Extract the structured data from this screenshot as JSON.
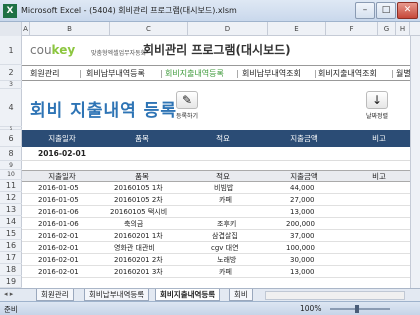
{
  "window": {
    "app_icon": "X",
    "title": "Microsoft Excel - (5404) 회비관리 프로그램(대시보드).xlsm",
    "min_label": "–",
    "max_label": "□",
    "close_label": "✕"
  },
  "columns": [
    "A",
    "B",
    "C",
    "D",
    "E",
    "F",
    "G",
    "H"
  ],
  "rows": [
    "1",
    "2",
    "3",
    "4",
    "5",
    "6",
    "7",
    "8",
    "9",
    "10",
    "11",
    "12",
    "13",
    "14",
    "15",
    "16",
    "17",
    "18",
    "19"
  ],
  "brand": {
    "cou": "cou",
    "key": "key",
    "tagline": "맞춤형엑셀업무자동화"
  },
  "app_title": "회비관리 프로그램(대시보드)",
  "nav": [
    "회원관리",
    "회비납부내역등록",
    "회비지출내역등록",
    "회비납부내역조회",
    "회비지출내역조회",
    "월별"
  ],
  "page_title": "회비 지출내역 등록",
  "buttons": {
    "register": {
      "icon": "✎",
      "label": "등록하기"
    },
    "sort": {
      "icon": "↓",
      "label": "날짜정렬"
    }
  },
  "input_header": [
    "지출일자",
    "품목",
    "적요",
    "지출금액",
    "비고"
  ],
  "input_row": {
    "date": "2016-02-01",
    "item": "",
    "desc": "",
    "amount": "",
    "note": ""
  },
  "list_header": [
    "지출일자",
    "품목",
    "적요",
    "지출금액",
    "비고"
  ],
  "list_rows": [
    {
      "date": "2016-01-05",
      "item": "20160105 1차",
      "desc": "비빔밥",
      "amount": "44,000"
    },
    {
      "date": "2016-01-05",
      "item": "20160105 2차",
      "desc": "카페",
      "amount": "27,000"
    },
    {
      "date": "2016-01-06",
      "item": "20160105 택시비",
      "desc": "",
      "amount": "13,000"
    },
    {
      "date": "2016-01-06",
      "item": "축의금",
      "desc": "조후키",
      "amount": "200,000"
    },
    {
      "date": "2016-02-01",
      "item": "20160201 1차",
      "desc": "삼겹살집",
      "amount": "37,000"
    },
    {
      "date": "2016-02-01",
      "item": "영화관 대관비",
      "desc": "cgv 대연",
      "amount": "100,000"
    },
    {
      "date": "2016-02-01",
      "item": "20160201 2차",
      "desc": "노래방",
      "amount": "30,000"
    },
    {
      "date": "2016-02-01",
      "item": "20160201 3차",
      "desc": "카페",
      "amount": "13,000"
    }
  ],
  "sheet_tabs": [
    "회원관리",
    "회비납부내역등록",
    "회비지출내역등록",
    "회비"
  ],
  "sheet_nav": "◂ ▸",
  "status": {
    "ready": "준비",
    "zoom": "100%"
  },
  "colors": {
    "header_bar": "#2b4c75",
    "title_blue": "#2e74b5",
    "active_nav": "#3d9a3a",
    "brand_green": "#8cc63f"
  }
}
